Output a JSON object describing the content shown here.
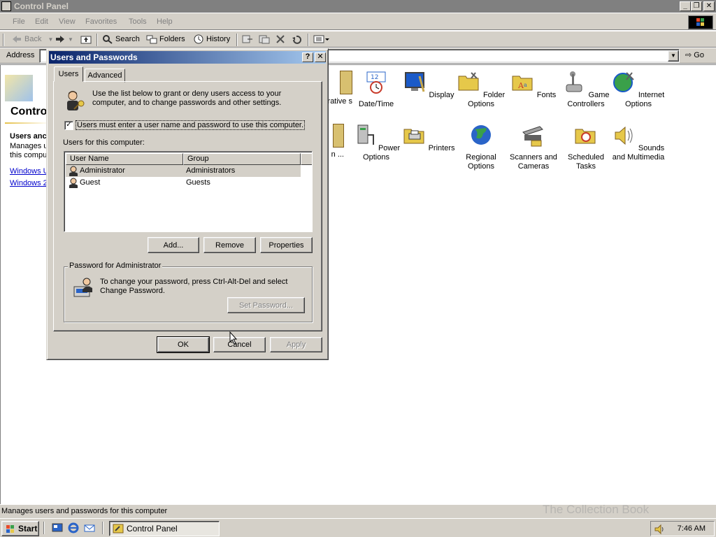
{
  "window": {
    "title": "Control Panel",
    "caption_buttons": [
      "_",
      "❐",
      "✕"
    ]
  },
  "menu": [
    "File",
    "Edit",
    "View",
    "Favorites",
    "Tools",
    "Help"
  ],
  "toolbar": {
    "back": "Back",
    "search": "Search",
    "folders": "Folders",
    "history": "History"
  },
  "address": {
    "label": "Address",
    "go": "Go"
  },
  "left_pane": {
    "title": "Contro",
    "heading": "Users anc",
    "desc": "Manages u this compu",
    "links": [
      "Windows U",
      "Windows 2"
    ]
  },
  "icons": [
    {
      "label": "rative s",
      "color": "#c8a64a"
    },
    {
      "label": "Date/Time",
      "color": "#2a64c8"
    },
    {
      "label": "Display",
      "color": "#1a5ac8"
    },
    {
      "label": "Folder Options",
      "color": "#e6c84a"
    },
    {
      "label": "Fonts",
      "color": "#e6c84a"
    },
    {
      "label": "Game Controllers",
      "color": "#909090"
    },
    {
      "label": "Internet Options",
      "color": "#3aa04a"
    },
    {
      "label": "and n ...",
      "color": "#c8a64a"
    },
    {
      "label": "Power Options",
      "color": "#a0a0a0"
    },
    {
      "label": "Printers",
      "color": "#e6c84a"
    },
    {
      "label": "Regional Options",
      "color": "#2a8a4a"
    },
    {
      "label": "Scanners and Cameras",
      "color": "#606060"
    },
    {
      "label": "Scheduled Tasks",
      "color": "#e6c84a"
    },
    {
      "label": "Sounds and Multimedia",
      "color": "#e6c84a"
    }
  ],
  "statusbar": "Manages users and passwords for this computer",
  "taskbar": {
    "start": "Start",
    "task": "Control Panel",
    "clock": "7:46 AM",
    "watermark": "The Collection Book"
  },
  "dialog": {
    "title": "Users and Passwords",
    "help_btn": "?",
    "close_btn": "✕",
    "tabs": [
      "Users",
      "Advanced"
    ],
    "intro": "Use the list below to grant or deny users access to your computer, and to change passwords and other settings.",
    "checkbox_label": "Users must enter a user name and password to use this computer.",
    "checkbox_checked": true,
    "users_label": "Users for this computer:",
    "columns": [
      "User Name",
      "Group"
    ],
    "users": [
      {
        "name": "Administrator",
        "group": "Administrators"
      },
      {
        "name": "Guest",
        "group": "Guests"
      }
    ],
    "buttons": {
      "add": "Add...",
      "remove": "Remove",
      "properties": "Properties"
    },
    "password_group": "Password for Administrator",
    "password_text": "To change your password, press Ctrl-Alt-Del and select Change Password.",
    "set_password": "Set Password...",
    "ok": "OK",
    "cancel": "Cancel",
    "apply": "Apply"
  }
}
